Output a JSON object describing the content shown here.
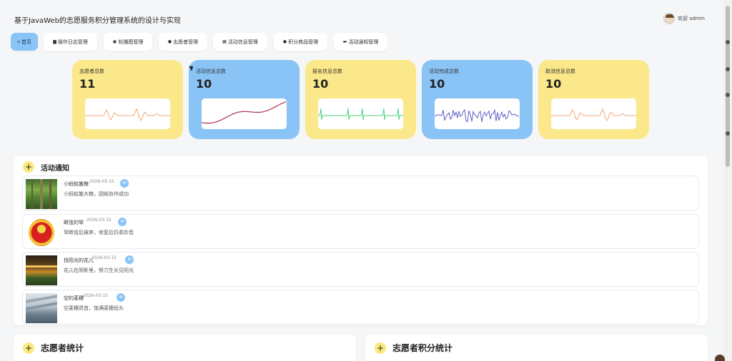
{
  "header": {
    "title": "基于JavaWeb的志愿服务积分管理系统的设计与实现",
    "welcome": "欢迎 admin"
  },
  "nav": {
    "tabs": [
      {
        "label": "首页",
        "icon": "home-icon",
        "glyph": "⌂",
        "active": true
      },
      {
        "label": "操作日志管理",
        "icon": "book-icon",
        "glyph": "▆"
      },
      {
        "label": "轮播图管理",
        "icon": "image-icon",
        "glyph": "▣"
      },
      {
        "label": "志愿者管理",
        "icon": "user-icon",
        "glyph": "●"
      },
      {
        "label": "活动信息管理",
        "icon": "grid-icon",
        "glyph": "▦"
      },
      {
        "label": "积分商品管理",
        "icon": "goods-icon",
        "glyph": "●"
      },
      {
        "label": "活动通知管理",
        "icon": "folder-icon",
        "glyph": "▬"
      }
    ]
  },
  "stats": [
    {
      "label": "志愿者总数",
      "value": "11",
      "bg": "#fbe88a",
      "line": "#f0a878",
      "style": "pulse"
    },
    {
      "label": "活动信息总数",
      "value": "10",
      "bg": "#8ac4f7",
      "line": "#b0304a",
      "style": "curve"
    },
    {
      "label": "报名信息总数",
      "value": "10",
      "bg": "#fbe88a",
      "line": "#49d27e",
      "style": "ecg"
    },
    {
      "label": "活动完成总数",
      "value": "10",
      "bg": "#8ac4f7",
      "line": "#5a5fc4",
      "style": "noise"
    },
    {
      "label": "取消信息总数",
      "value": "10",
      "bg": "#fbe88a",
      "line": "#f0a878",
      "style": "pulse"
    }
  ],
  "notices_panel": {
    "title": "活动通知",
    "items": [
      {
        "title": "小蚂蚁搬粮",
        "date": "2026-03-15",
        "desc": "小蚂蚁搬大粮，团结协作成功",
        "thumb": "forest"
      },
      {
        "title": "断弦的琴",
        "date": "2026-03-15",
        "desc": "琴断弦后被弃，修复后仍奏妙音",
        "thumb": "badge"
      },
      {
        "title": "找阳光的花儿",
        "date": "2026-03-15",
        "desc": "花儿在阴影里，努力生长见阳光",
        "thumb": "hall"
      },
      {
        "title": "空的麦穗",
        "date": "2026-03-15",
        "desc": "空麦穗昂首，饱满麦穗低头",
        "thumb": "building"
      }
    ]
  },
  "volunteer_stats": {
    "title": "志愿者统计"
  },
  "points_stats": {
    "title": "志愿者积分统计"
  },
  "colors": {
    "accent": "#8ac4f7",
    "yellow": "#fbe88a",
    "plus": "#fbe97b"
  }
}
